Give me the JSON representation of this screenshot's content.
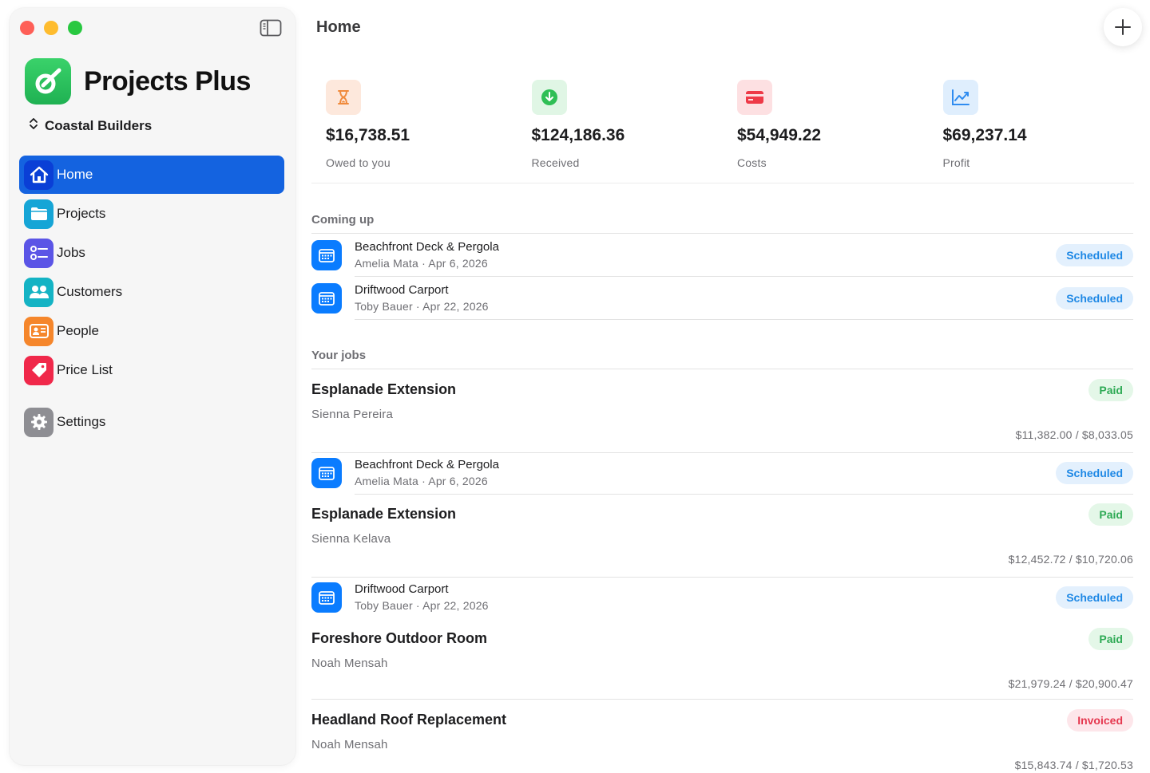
{
  "window": {
    "title": "Home"
  },
  "sidebar": {
    "brand": "Projects Plus",
    "workspace": "Coastal Builders",
    "items": [
      {
        "label": "Home",
        "icon": "house-icon",
        "color": "#0a3fd6",
        "active": true
      },
      {
        "label": "Projects",
        "icon": "folder-icon",
        "color": "#16a5d6"
      },
      {
        "label": "Jobs",
        "icon": "checklist-icon",
        "color": "#5b55e6"
      },
      {
        "label": "Customers",
        "icon": "people-icon",
        "color": "#14b3c4"
      },
      {
        "label": "People",
        "icon": "contact-card-icon",
        "color": "#f5862b"
      },
      {
        "label": "Price List",
        "icon": "tag-icon",
        "color": "#f0284a"
      }
    ],
    "settings": {
      "label": "Settings",
      "icon": "gear-icon",
      "color": "#8e8e93"
    }
  },
  "stats": [
    {
      "value": "$16,738.51",
      "label": "Owed to you",
      "icon": "hourglass-icon",
      "bg": "#fde8dc",
      "fg": "#f08a3c"
    },
    {
      "value": "$124,186.36",
      "label": "Received",
      "icon": "arrow-down-circle-icon",
      "bg": "#e0f6e5",
      "fg": "#2fbf55"
    },
    {
      "value": "$54,949.22",
      "label": "Costs",
      "icon": "credit-card-icon",
      "bg": "#fde0e2",
      "fg": "#ee3a48"
    },
    {
      "value": "$69,237.14",
      "label": "Profit",
      "icon": "chart-line-icon",
      "bg": "#dfeefd",
      "fg": "#2f8cf0"
    }
  ],
  "coming_up": {
    "title": "Coming up",
    "items": [
      {
        "title": "Beachfront Deck & Pergola",
        "sub": "Amelia Mata · Apr 6, 2026",
        "status": "Scheduled"
      },
      {
        "title": "Driftwood Carport",
        "sub": "Toby Bauer · Apr 22, 2026",
        "status": "Scheduled"
      }
    ]
  },
  "your_jobs": {
    "title": "Your jobs",
    "jobs": [
      {
        "title": "Esplanade Extension",
        "sub": "Sienna Pereira",
        "status": "Paid",
        "amount": "$11,382.00 / $8,033.05"
      },
      {
        "title": "Beachfront Deck & Pergola",
        "sub": "Amelia Mata · Apr 6, 2026",
        "status": "Scheduled"
      },
      {
        "title": "Esplanade Extension",
        "sub": "Sienna Kelava",
        "status": "Paid",
        "amount": "$12,452.72 / $10,720.06"
      },
      {
        "title": "Driftwood Carport",
        "sub": "Toby Bauer · Apr 22, 2026",
        "status": "Scheduled"
      },
      {
        "title": "Foreshore Outdoor Room",
        "sub": "Noah Mensah",
        "status": "Paid",
        "amount": "$21,979.24 / $20,900.47"
      },
      {
        "title": "Headland Roof Replacement",
        "sub": "Noah Mensah",
        "status": "Invoiced",
        "amount": "$15,843.74 / $1,720.53"
      }
    ]
  }
}
